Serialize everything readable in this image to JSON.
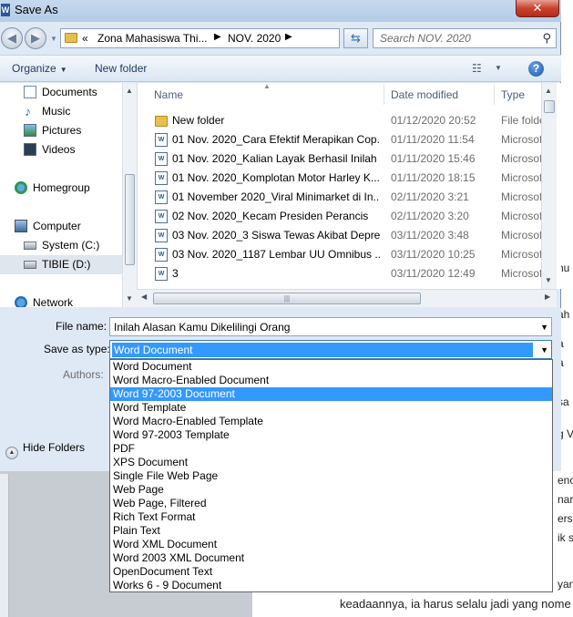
{
  "window": {
    "title": "Save As",
    "app_icon": "word-icon",
    "close_label": "✕"
  },
  "address_bar": {
    "overflow": "«",
    "crumbs": [
      "Zona Mahasiswa Thi...",
      "NOV. 2020"
    ],
    "search_placeholder": "Search NOV. 2020"
  },
  "toolbar": {
    "organize": "Organize",
    "new_folder": "New folder",
    "help": "?"
  },
  "nav_pane": {
    "items": [
      {
        "label": "Documents",
        "icon": "documents-icon"
      },
      {
        "label": "Music",
        "icon": "music-icon"
      },
      {
        "label": "Pictures",
        "icon": "pictures-icon"
      },
      {
        "label": "Videos",
        "icon": "videos-icon"
      },
      {
        "label": "Homegroup",
        "icon": "homegroup-icon"
      },
      {
        "label": "Computer",
        "icon": "computer-icon"
      },
      {
        "label": "System (C:)",
        "icon": "drive-icon"
      },
      {
        "label": "TIBIE (D:)",
        "icon": "drive-icon"
      },
      {
        "label": "Network",
        "icon": "network-icon"
      }
    ]
  },
  "file_list": {
    "columns": {
      "name": "Name",
      "date": "Date modified",
      "type": "Type"
    },
    "rows": [
      {
        "name": "New folder",
        "date": "01/12/2020 20:52",
        "type": "File folder",
        "icon": "folder-icon"
      },
      {
        "name": "01 Nov. 2020_Cara Efektif Merapikan Cop...",
        "date": "01/11/2020 11:54",
        "type": "Microsoft",
        "icon": "word-doc-icon"
      },
      {
        "name": "01 Nov. 2020_Kalian Layak Berhasil Inilah ...",
        "date": "01/11/2020 15:46",
        "type": "Microsoft",
        "icon": "word-doc-icon"
      },
      {
        "name": "01 Nov. 2020_Komplotan Motor Harley K...",
        "date": "01/11/2020 18:15",
        "type": "Microsoft",
        "icon": "word-doc-icon"
      },
      {
        "name": "01 November 2020_Viral Minimarket di In...",
        "date": "02/11/2020 3:21",
        "type": "Microsoft",
        "icon": "word-doc-icon"
      },
      {
        "name": "02 Nov. 2020_Kecam Presiden Perancis",
        "date": "02/11/2020 3:20",
        "type": "Microsoft",
        "icon": "word-doc-icon"
      },
      {
        "name": "03 Nov. 2020_3 Siswa Tewas Akibat Depre...",
        "date": "03/11/2020 3:48",
        "type": "Microsoft",
        "icon": "word-doc-icon"
      },
      {
        "name": "03 Nov. 2020_1187 Lembar UU Omnibus ...",
        "date": "03/11/2020 10:25",
        "type": "Microsoft",
        "icon": "word-doc-icon"
      },
      {
        "name": "3",
        "date": "03/11/2020 12:49",
        "type": "Microsoft",
        "icon": "word-doc-icon"
      }
    ]
  },
  "form": {
    "file_name_label": "File name:",
    "file_name_value": "Inilah Alasan Kamu Dikelilingi Orang",
    "save_type_label": "Save as type:",
    "save_type_value": "Word Document",
    "authors_label": "Authors:",
    "hide_folders": "Hide Folders"
  },
  "save_type_options": {
    "highlighted_index": 2,
    "items": [
      "Word Document",
      "Word Macro-Enabled Document",
      "Word 97-2003 Document",
      "Word Template",
      "Word Macro-Enabled Template",
      "Word 97-2003 Template",
      "PDF",
      "XPS Document",
      "Single File Web Page",
      "Web Page",
      "Web Page, Filtered",
      "Rich Text Format",
      "Plain Text",
      "Word XML Document",
      "Word 2003 XML Document",
      "OpenDocument Text",
      "Works 6 - 9 Document"
    ]
  },
  "background_doc": {
    "line_1": "keadaannya, ia harus selalu jadi yang nome",
    "fragments": [
      "hu",
      "ah",
      "a",
      "a",
      "sa",
      "g V",
      "enc",
      "naru",
      "erse",
      "ik se",
      "yan,"
    ]
  },
  "colors": {
    "highlight": "#3399ff",
    "dialog_bg": "#dfe9f5",
    "link_text": "#1e395b"
  }
}
